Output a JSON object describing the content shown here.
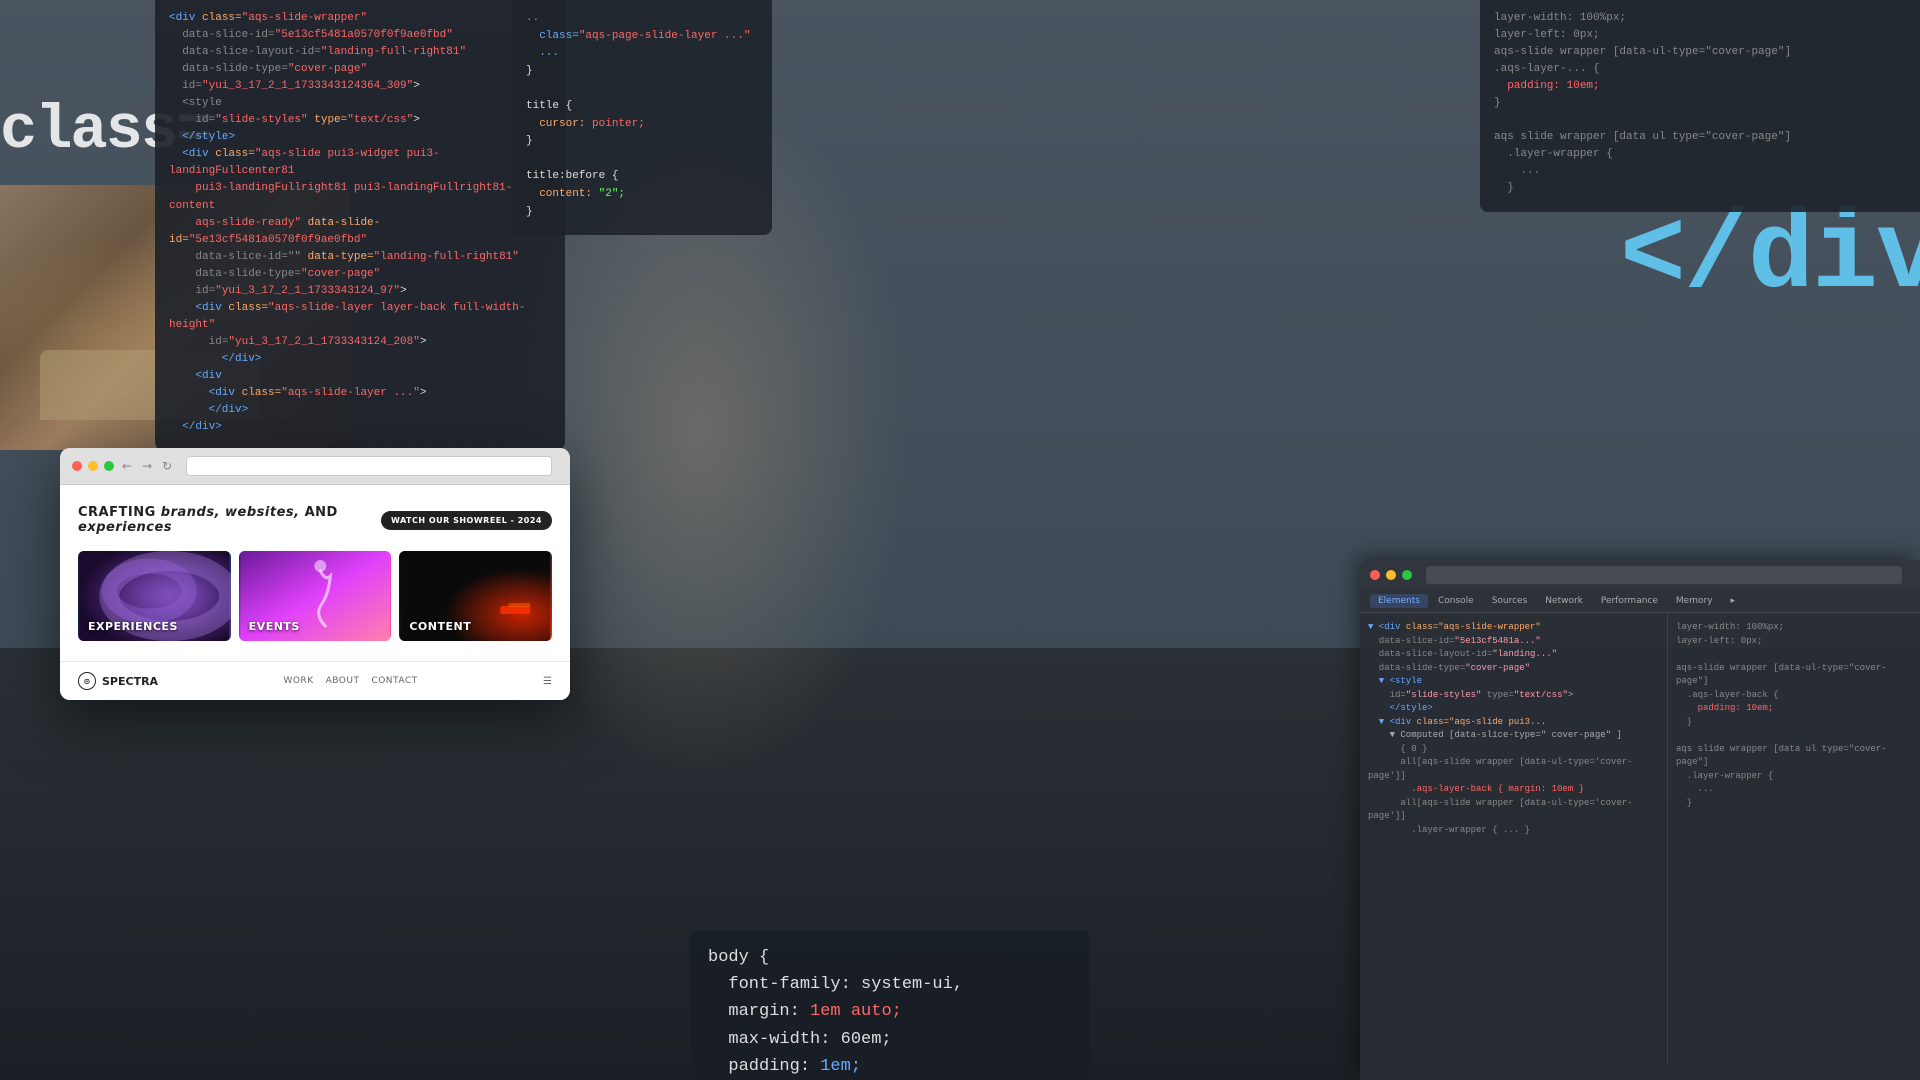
{
  "scene": {
    "bg_description": "Developer workspace with blurred person wearing glasses"
  },
  "code_panel_tl": {
    "lines": [
      {
        "text": "<div class=\"aqs-slide-wrapper\"",
        "color": "tag"
      },
      {
        "text": "  data-slice-id=\"5e13cf5481a0570f0f9ae0fbd\"",
        "color": "attr"
      },
      {
        "text": "  data-slice-layout-id=\"landing-full-right81\"",
        "color": "attr"
      },
      {
        "text": "  data-slide-type=\"cover-page\"",
        "color": "string"
      },
      {
        "text": "  id=\"yui_3_17_2_1_1733343124364_309\">",
        "color": "attr"
      },
      {
        "text": "    <style",
        "color": "tag"
      },
      {
        "text": "      id=\"slide-styles\" type=\"text/css\">",
        "color": "attr"
      },
      {
        "text": "    </style>",
        "color": "tag"
      },
      {
        "text": "    <div class=\"aqs-slide pui3-widget pui3-landingFullcenter81",
        "color": "tag"
      },
      {
        "text": "      pui3-landingFullright81 pui3-landingFullright81-content",
        "color": "attr"
      },
      {
        "text": "      aqs-slide-ready\" data-slide-id=\"5e13cf5481a0570f0f9ae0fbd\"",
        "color": "attr"
      },
      {
        "text": "      data-slice-id=\"\" data-type=\"landing-full-right81\"",
        "color": "attr"
      },
      {
        "text": "      data-slide-type=\"cover-page\"",
        "color": "string"
      },
      {
        "text": "      id=\"yui_3_17_2_1_1733343124_97\">",
        "color": "attr"
      },
      {
        "text": "      <div class=\"aqs-slide-layer layer-back full-width-height\"",
        "color": "tag"
      },
      {
        "text": "        id=\"yui_3_17_2_1_1733343124_208\">",
        "color": "attr"
      },
      {
        "text": "          </div>",
        "color": "tag"
      },
      {
        "text": "      <div",
        "color": "tag"
      },
      {
        "text": "        <div class=\"aqs-slide-layer ...\">",
        "color": "tag"
      },
      {
        "text": "        </div>",
        "color": "tag"
      },
      {
        "text": "    </div>",
        "color": "tag"
      }
    ]
  },
  "code_panel_tc": {
    "lines": [
      {
        "text": "..",
        "color": "muted"
      },
      {
        "text": "  class=\"aqs-page-slide-layer ...\"",
        "color": "blue"
      },
      {
        "text": "  ...",
        "color": "blue"
      },
      {
        "text": "}",
        "color": "white"
      },
      {
        "text": "",
        "color": "white"
      },
      {
        "text": "title {",
        "color": "white"
      },
      {
        "text": "  cursor: pointer;",
        "color": "orange"
      },
      {
        "text": "}",
        "color": "white"
      },
      {
        "text": "",
        "color": "white"
      },
      {
        "text": "title:before {",
        "color": "white"
      },
      {
        "text": "  content: \"2\";",
        "color": "green"
      },
      {
        "text": "}",
        "color": "white"
      }
    ]
  },
  "code_panel_tr": {
    "lines": [
      {
        "text": "layer-width: 100%px;",
        "color": "muted"
      },
      {
        "text": "layer-left: 0px;",
        "color": "muted"
      },
      {
        "text": "aqs-slide wrapper [data-ul-type=\"cover-page\"]",
        "color": "muted"
      },
      {
        "text": ".aqs-layer-... {",
        "color": "muted"
      },
      {
        "text": "  padding: 10em;",
        "color": "red"
      },
      {
        "text": "}",
        "color": "muted"
      },
      {
        "text": "",
        "color": "muted"
      },
      {
        "text": "aqs slide wrapper [data ul type=\"cover-page\"]",
        "color": "muted"
      },
      {
        "text": "  .layer-wrapper {",
        "color": "muted"
      },
      {
        "text": "    ...",
        "color": "muted"
      },
      {
        "text": "  }",
        "color": "muted"
      }
    ]
  },
  "class_text": "class=",
  "div_text": "</div",
  "interior_description": "Cozy interior room with sofa",
  "browser_main": {
    "hero_text": "CRAFTING brands, websites, AND experiences",
    "watch_btn": "WATCH OUR SHOWREEL - 2024",
    "cards": [
      {
        "label": "EXPERIENCES",
        "color": "#1a1a3e"
      },
      {
        "label": "EVENTS",
        "color": "#7b1fa2"
      },
      {
        "label": "CONTENT",
        "color": "#1a1a1a"
      }
    ],
    "footer": {
      "logo": "SPECTRA",
      "nav": [
        "WORK",
        "ABOUT",
        "CONTACT"
      ]
    }
  },
  "css_code": {
    "lines": [
      {
        "text": "body {",
        "color": "white"
      },
      {
        "text": "  font-family: system-ui,",
        "color": "white"
      },
      {
        "text": "  margin: 1em auto;",
        "color": "red_value"
      },
      {
        "text": "  max-width: 60em;",
        "color": "white"
      },
      {
        "text": "  padding: 1em;",
        "color": "blue_value"
      }
    ]
  },
  "devtools": {
    "tabs": [
      "Elements",
      "Console",
      "Sources",
      "Network",
      "Performance",
      "Memory",
      "▸"
    ],
    "left_code": [
      "▼ <div class=\"aqs-slide-wrapper\"",
      "   data-slice-id=\"5e13cf5481a...\"",
      "   data-slice-layout-id=\"landing...\"",
      "   data-slide-type=\"cover-page\"",
      "  ▼ <style",
      "    id=\"slide-styles\" type=\"text/css\">",
      "    </style>",
      "  ▼ <div class=\"aqs-slide pui3...",
      "    ▼ Computed [data-slice-type=\" cover-page\" ]",
      "      { 0 }",
      "      all[aqs-slide wrapper [data-ul-type='cover-page']]",
      "        .aqs-layer-back { margin: 10em }",
      "      all[aqs-slide wrapper [data-ul-type='cover-page']]",
      "        .layer-wrapper { ... }",
      "      ..."
    ],
    "right_code": [
      "layer-width: 100%px;",
      "layer-left: 0px;",
      "",
      "aqs-slide wrapper [data-ul-type=\"cover-page\"]",
      "  .aqs-layer-back {",
      "    padding: 10em;",
      "  }",
      "",
      "aqs slide wrapper [data ul type=\"cover-page\"]",
      "  .layer-wrapper {",
      "    ...",
      "  }"
    ]
  }
}
